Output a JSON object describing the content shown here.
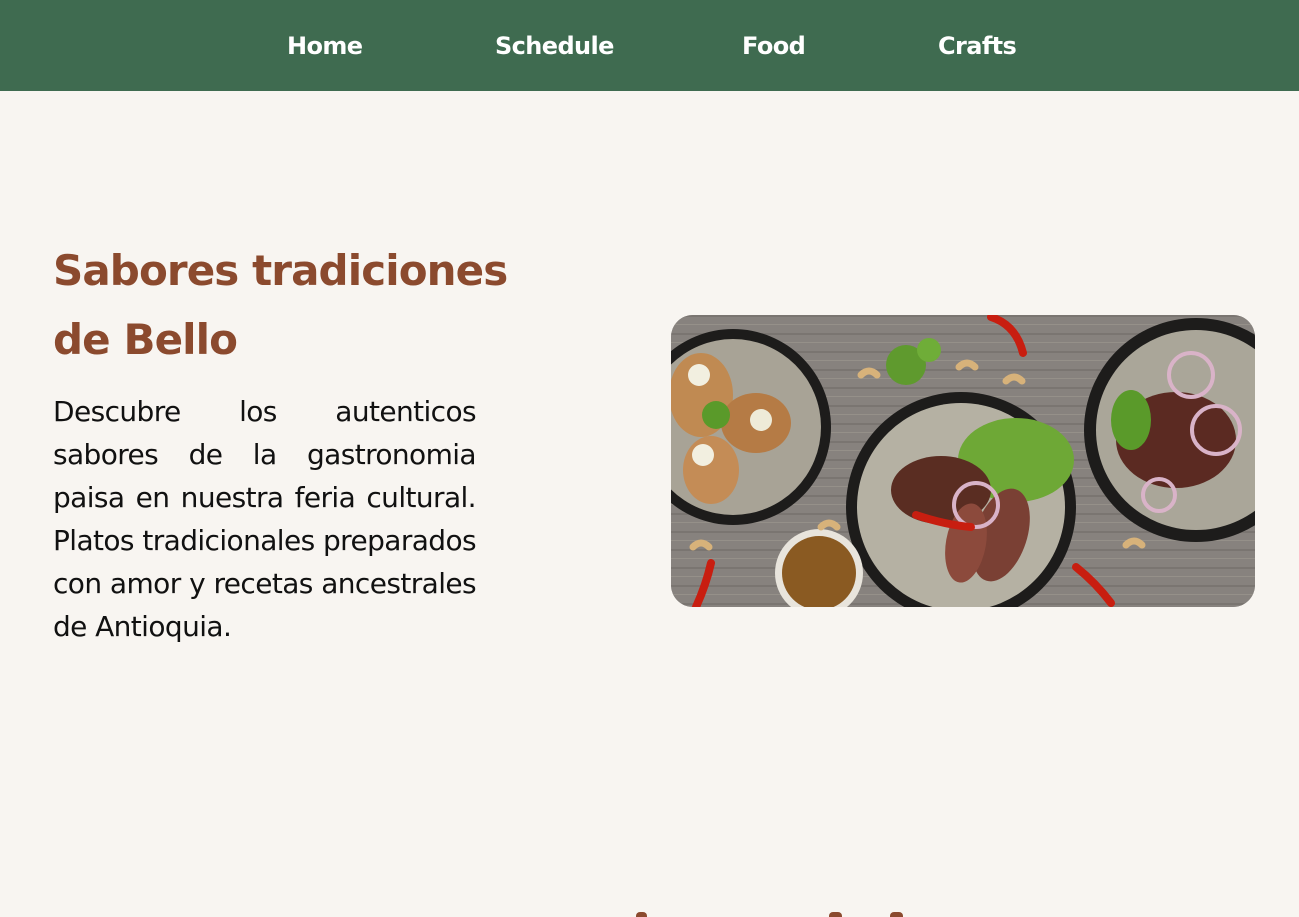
{
  "nav": {
    "items": [
      {
        "label": "Home"
      },
      {
        "label": "Schedule"
      },
      {
        "label": "Food"
      },
      {
        "label": "Crafts"
      }
    ]
  },
  "hero": {
    "title": "Sabores tradiciones de Bello",
    "description": "Descubre los autenticos sabores de la gastronomia paisa en nuestra feria cultural. Platos tradicionales preparados con amor y recetas ancestrales de Antioquia."
  },
  "colors": {
    "nav_background": "#3f6b50",
    "page_background": "#f8f5f1",
    "accent": "#8b4a2e",
    "text": "#111111"
  }
}
